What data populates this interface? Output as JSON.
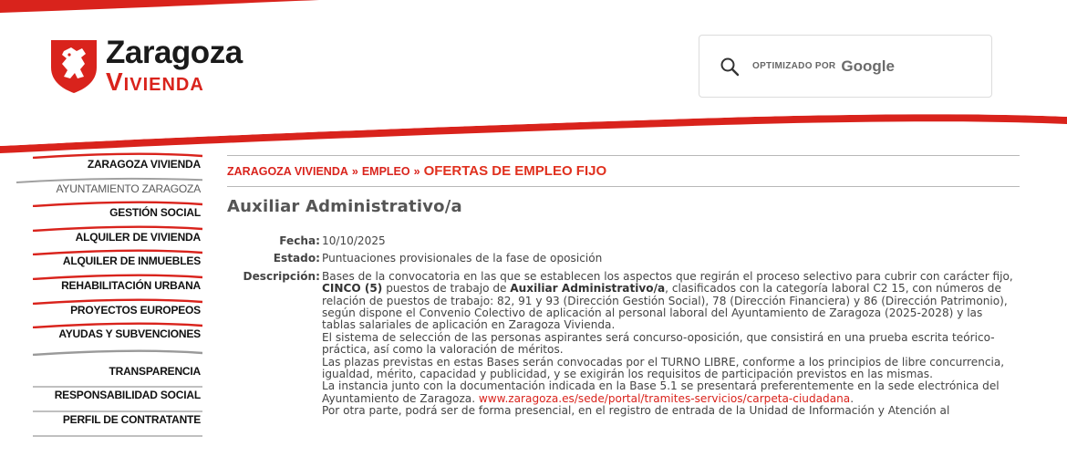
{
  "header": {
    "logo": {
      "line1": "Zaragoza",
      "line2": "Vivienda"
    },
    "search": {
      "powered_by": "OPTIMIZADO POR",
      "provider": "Google"
    }
  },
  "menu": {
    "items": [
      {
        "label": "ZARAGOZA VIVIENDA"
      },
      {
        "label": "AYUNTAMIENTO ZARAGOZA"
      },
      {
        "label": "GESTIÓN SOCIAL"
      },
      {
        "label": "ALQUILER DE VIVIENDA"
      },
      {
        "label": "ALQUILER DE INMUEBLES"
      },
      {
        "label": "REHABILITACIÓN URBANA"
      },
      {
        "label": "PROYECTOS EUROPEOS"
      },
      {
        "label": "AYUDAS Y SUBVENCIONES"
      },
      {
        "label": "TRANSPARENCIA"
      },
      {
        "label": "RESPONSABILIDAD SOCIAL"
      },
      {
        "label": "PERFIL DE CONTRATANTE"
      }
    ]
  },
  "breadcrumb": {
    "item1": "ZARAGOZA VIVIENDA",
    "sep": "»",
    "item2": "EMPLEO",
    "current": "OFERTAS DE EMPLEO FIJO"
  },
  "page": {
    "title": "Auxiliar Administrativo/a",
    "fecha_label": "Fecha:",
    "fecha": "10/10/2025",
    "estado_label": "Estado:",
    "estado": "Puntuaciones provisionales de la fase de oposición",
    "descripcion_label": "Descripción:",
    "desc": {
      "p1_a": "Bases de la convocatoria en las que se establecen los aspectos que regirán el proceso selectivo para cubrir con carácter fijo, ",
      "p1_b": "CINCO (5)",
      "p1_c": " puestos de trabajo de ",
      "p1_d": "Auxiliar Administrativo/a",
      "p1_e": ", clasificados con la categoría laboral C2 15, con números de relación de puestos de trabajo: 82, 91 y 93 (Dirección Gestión Social), 78 (Dirección Financiera) y 86 (Dirección Patrimonio), según dispone el Convenio Colectivo de aplicación al personal laboral del Ayuntamiento de Zaragoza (2025-2028) y las tablas salariales de aplicación en Zaragoza Vivienda.",
      "p2": "El sistema de selección de las personas aspirantes será concurso-oposición, que consistirá en una prueba escrita teórico-práctica, así como la valoración de méritos.",
      "p3": "Las plazas previstas en estas Bases serán convocadas por el TURNO LIBRE, conforme a los principios de libre concurrencia, igualdad, mérito, capacidad y publicidad, y se exigirán los requisitos de participación previstos en las mismas.",
      "p4_a": "La instancia junto con la documentación indicada en la Base 5.1 se presentará preferentemente en la sede electrónica del Ayuntamiento de Zaragoza. ",
      "p4_link": "www.zaragoza.es/sede/portal/tramites-servicios/carpeta-ciudadana",
      "p4_b": ".",
      "p5": "Por otra parte, podrá ser de forma presencial, en el registro de entrada de la Unidad de Información y Atención al"
    }
  },
  "colors": {
    "brand_red": "#d9231c",
    "menu_gray": "#9a9a9a"
  }
}
